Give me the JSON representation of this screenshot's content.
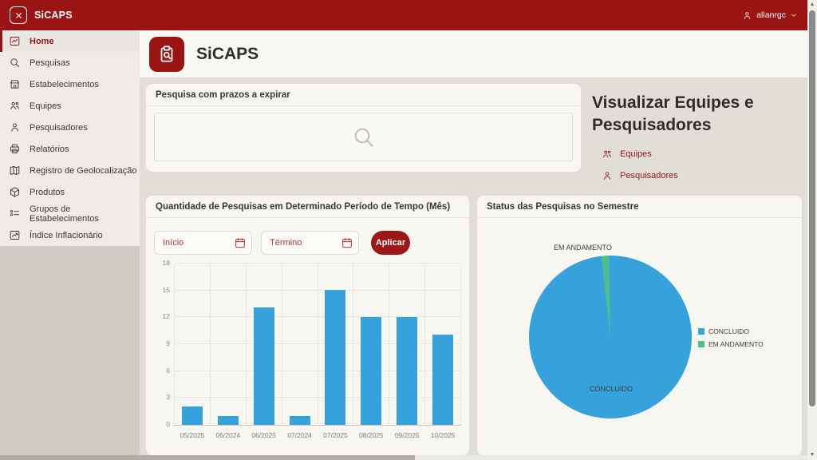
{
  "topbar": {
    "app_title": "SiCAPS",
    "user": "allanrgc"
  },
  "sidebar": {
    "items": [
      {
        "label": "Home",
        "icon": "home",
        "active": true
      },
      {
        "label": "Pesquisas",
        "icon": "search",
        "active": false
      },
      {
        "label": "Estabelecimentos",
        "icon": "storefront",
        "active": false
      },
      {
        "label": "Equipes",
        "icon": "people",
        "active": false
      },
      {
        "label": "Pesquisadores",
        "icon": "person",
        "active": false
      },
      {
        "label": "Relatórios",
        "icon": "printer",
        "active": false
      },
      {
        "label": "Registro de Geolocalização",
        "icon": "map",
        "active": false
      },
      {
        "label": "Produtos",
        "icon": "box",
        "active": false
      },
      {
        "label": "Grupos de Estabelecimentos",
        "icon": "list",
        "active": false
      },
      {
        "label": "Índice Inflacionário",
        "icon": "trend",
        "active": false
      }
    ]
  },
  "header": {
    "title": "SiCAPS"
  },
  "expiring_panel": {
    "title": "Pesquisa com prazos a expirar"
  },
  "teams_section": {
    "title": "Visualizar Equipes e Pesquisadores",
    "links": [
      {
        "label": "Equipes"
      },
      {
        "label": "Pesquisadores"
      }
    ]
  },
  "bar_panel": {
    "title": "Quantidade de Pesquisas em Determinado Período de Tempo (Mês)",
    "inicio_placeholder": "Início",
    "termino_placeholder": "Término",
    "apply_label": "Aplicar"
  },
  "pie_panel": {
    "title": "Status das Pesquisas no Semestre"
  },
  "chart_data": [
    {
      "type": "bar",
      "title": "Quantidade de Pesquisas em Determinado Período de Tempo (Mês)",
      "categories": [
        "05/2025",
        "06/2024",
        "06/2025",
        "07/2024",
        "07/2025",
        "08/2025",
        "09/2025",
        "10/2025"
      ],
      "values": [
        2,
        1,
        13,
        1,
        15,
        12,
        12,
        10
      ],
      "xlabel": "",
      "ylabel": "",
      "ylim": [
        0,
        18
      ],
      "ytick_step": 3,
      "bar_color": "#36A2DB",
      "grid": true,
      "legend_position": "none"
    },
    {
      "type": "pie",
      "title": "Status das Pesquisas no Semestre",
      "slices": [
        {
          "label": "CONCLUIDO",
          "value": 98.5,
          "color": "#36A2DB"
        },
        {
          "label": "EM ANDAMENTO",
          "value": 1.5,
          "color": "#4DBE8C"
        }
      ],
      "legend_position": "right"
    }
  ],
  "colors": {
    "brand_red": "#9B1414",
    "bar_blue": "#36A2DB",
    "pie_green": "#4DBE8C"
  }
}
